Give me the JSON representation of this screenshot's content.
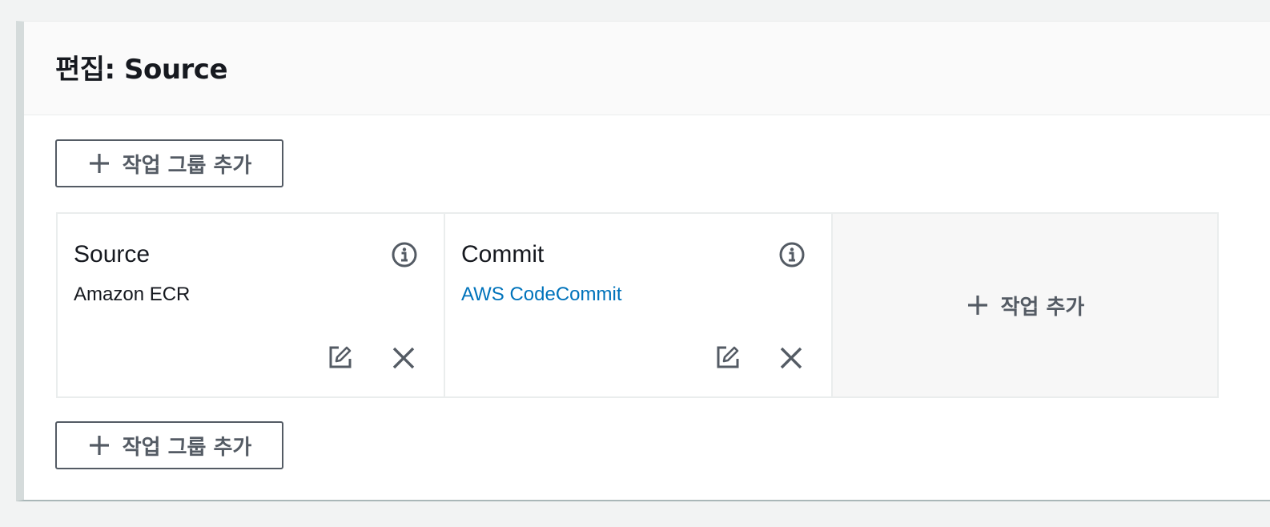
{
  "panel": {
    "title": "편집: Source"
  },
  "add_group_top": {
    "label": "작업 그룹 추가",
    "icon": "plus-icon"
  },
  "add_group_bottom": {
    "label": "작업 그룹 추가",
    "icon": "plus-icon"
  },
  "actions": [
    {
      "name": "Source",
      "provider": "Amazon ECR",
      "provider_is_link": false,
      "icons": [
        "info-icon",
        "edit-icon",
        "close-icon"
      ]
    },
    {
      "name": "Commit",
      "provider": "AWS CodeCommit",
      "provider_is_link": true,
      "icons": [
        "info-icon",
        "edit-icon",
        "close-icon"
      ]
    }
  ],
  "add_action": {
    "label": "작업 추가",
    "icon": "plus-icon"
  },
  "colors": {
    "text": "#16191f",
    "secondary": "#545b64",
    "link": "#0073bb",
    "border": "#eaeded",
    "header_bg": "#fafafa",
    "page_bg": "#f2f3f3"
  }
}
